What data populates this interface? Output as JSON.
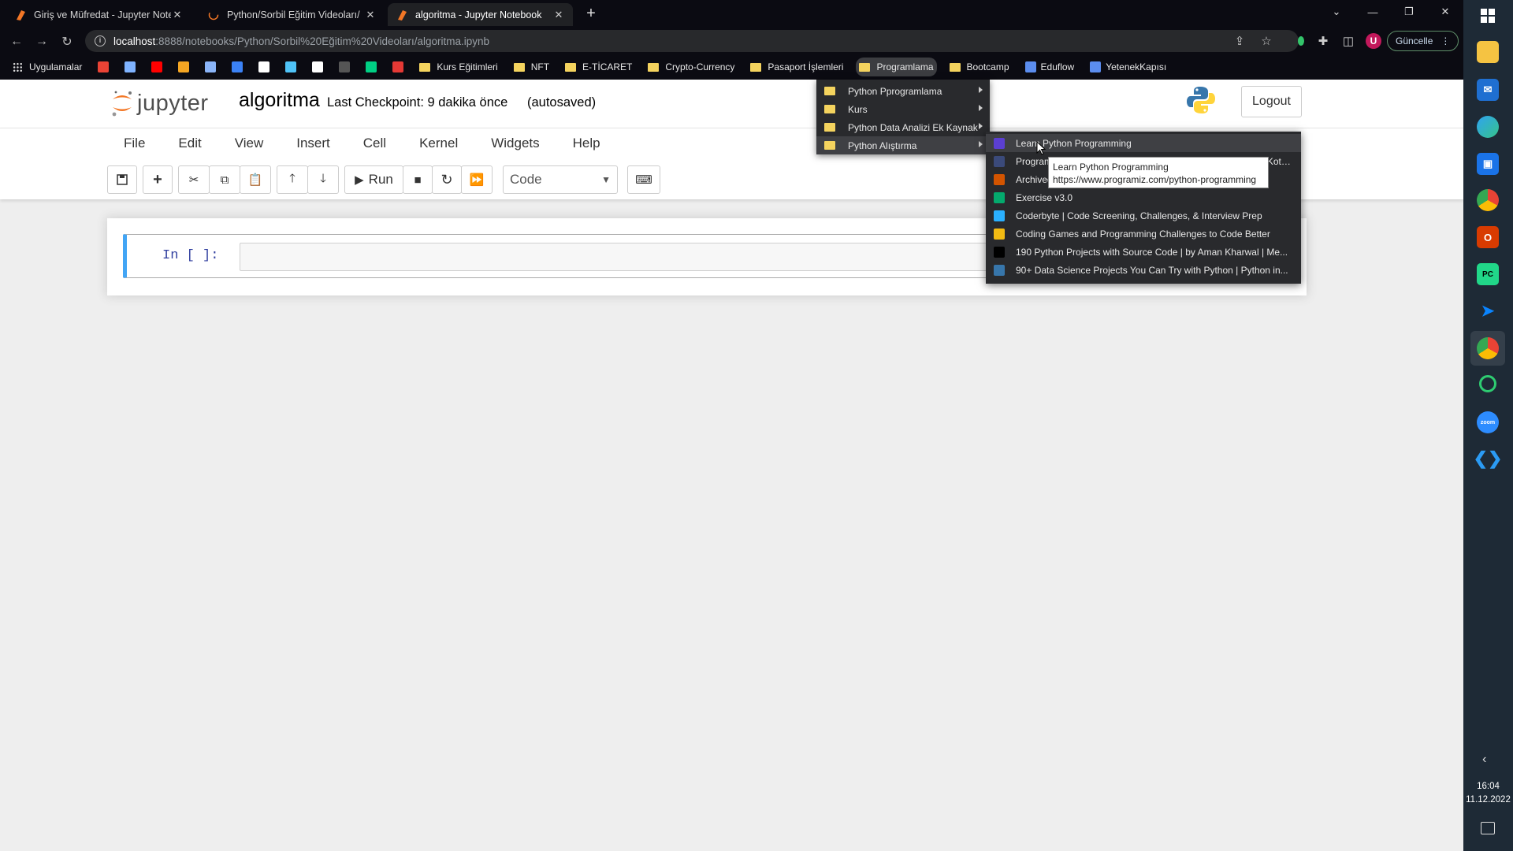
{
  "browser": {
    "tabs": [
      {
        "title": "Giriş ve Müfredat - Jupyter Note",
        "favicon": "jupyter-icon"
      },
      {
        "title": "Python/Sorbil Eğitim Videoları/",
        "favicon": "jupyter-loading-icon"
      },
      {
        "title": "algoritma - Jupyter Notebook",
        "favicon": "jupyter-icon"
      }
    ],
    "url_host": "localhost",
    "url_path": ":8888/notebooks/Python/Sorbil%20Eğitim%20Videoları/algoritma.ipynb",
    "update_label": "Güncelle",
    "profile_initial": "U",
    "bookmarks": [
      {
        "label": "Uygulamalar",
        "type": "apps"
      },
      {
        "label": "",
        "type": "gmail",
        "color": "#ea4335"
      },
      {
        "label": "",
        "type": "site",
        "color": "#7fb3ff"
      },
      {
        "label": "",
        "type": "youtube",
        "color": "#ff0000"
      },
      {
        "label": "",
        "type": "site",
        "color": "#f5a623"
      },
      {
        "label": "",
        "type": "site",
        "color": "#8ab4f8"
      },
      {
        "label": "",
        "type": "site",
        "color": "#3b82f6"
      },
      {
        "label": "",
        "type": "site",
        "color": "#ffffff"
      },
      {
        "label": "",
        "type": "site",
        "color": "#4fc3f7"
      },
      {
        "label": "",
        "type": "site",
        "color": "#ffffff"
      },
      {
        "label": "",
        "type": "site",
        "color": "#555555"
      },
      {
        "label": "",
        "type": "site",
        "color": "#00d084"
      },
      {
        "label": "",
        "type": "site",
        "color": "#e53935"
      },
      {
        "label": "Kurs Eğitimleri",
        "type": "folder"
      },
      {
        "label": "NFT",
        "type": "folder"
      },
      {
        "label": "E-TİCARET",
        "type": "folder"
      },
      {
        "label": "Crypto-Currency",
        "type": "folder"
      },
      {
        "label": "Pasaport İşlemleri",
        "type": "folder"
      },
      {
        "label": "Programlama",
        "type": "folder"
      },
      {
        "label": "Bootcamp",
        "type": "folder"
      },
      {
        "label": "Eduflow",
        "type": "site"
      },
      {
        "label": "YetenekKapısı",
        "type": "site"
      }
    ]
  },
  "jupyter": {
    "logo_text": "jupyter",
    "notebook_name": "algoritma",
    "checkpoint": "Last Checkpoint: 9 dakika önce",
    "autosaved": "(autosaved)",
    "logout_label": "Logout",
    "menu": [
      "File",
      "Edit",
      "View",
      "Insert",
      "Cell",
      "Kernel",
      "Widgets",
      "Help"
    ],
    "run_label": "Run",
    "cell_type": "Code",
    "cell_prompt": "In [ ]:"
  },
  "folder_menu": {
    "items": [
      "Python Pprogramlama",
      "Kurs",
      "Python Data Analizi Ek Kaynak",
      "Python Alıştırma"
    ]
  },
  "sub_menu": {
    "items": [
      {
        "label": "Learn Python Programming",
        "icon": "programiz-icon",
        "color": "#5b3fd1"
      },
      {
        "label": "Programiz: Learn to Code for Free - Learn Python, Java, C, Kotlin, and More",
        "icon": "site-icon",
        "color": "#3b4a7a"
      },
      {
        "label": "Archived Problems - Project Euler",
        "icon": "pe-icon",
        "color": "#d35400"
      },
      {
        "label": "Exercise v3.0",
        "icon": "w3-icon",
        "color": "#04aa6d"
      },
      {
        "label": "Coderbyte | Code Screening, Challenges, & Interview Prep",
        "icon": "coderbyte-icon",
        "color": "#2ab0ff"
      },
      {
        "label": "Coding Games and Programming Challenges to Code Better",
        "icon": "codingame-icon",
        "color": "#f2bb13"
      },
      {
        "label": "190 Python Projects with Source Code | by Aman Kharwal | Me...",
        "icon": "medium-icon",
        "color": "#000000"
      },
      {
        "label": "90+ Data Science Projects You Can Try with Python | Python in...",
        "icon": "py-icon",
        "color": "#3776ab"
      }
    ]
  },
  "tooltip": {
    "title": "Learn Python Programming",
    "url": "https://www.programiz.com/python-programming"
  },
  "taskbar": {
    "time": "16:04",
    "date": "11.12.2022"
  }
}
